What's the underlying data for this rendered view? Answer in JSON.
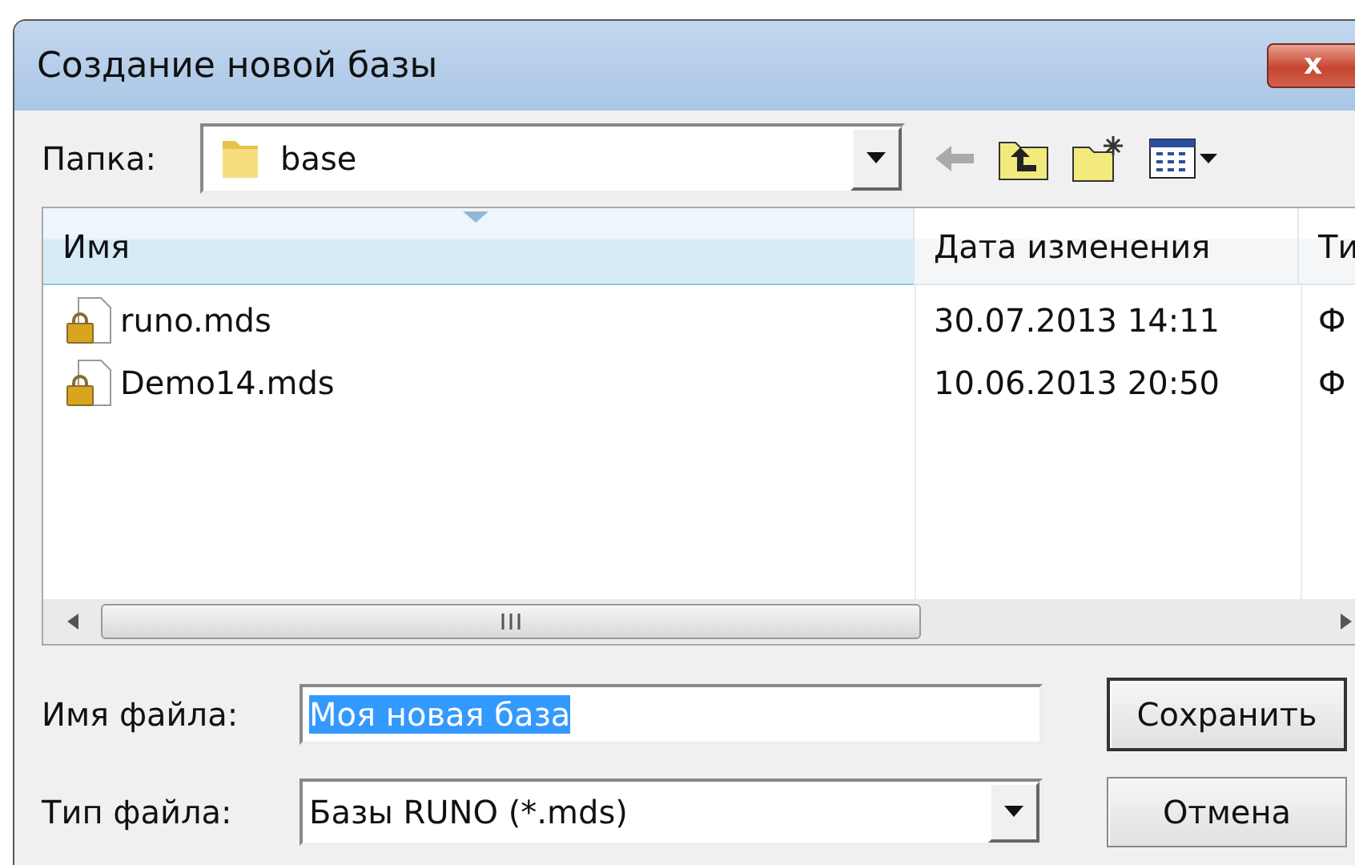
{
  "window": {
    "title": "Создание новой базы",
    "close_glyph": "x"
  },
  "folder": {
    "label": "Папка:",
    "value": "base"
  },
  "table": {
    "columns": [
      {
        "label": "Имя",
        "sorted": true
      },
      {
        "label": "Дата изменения",
        "sorted": false
      },
      {
        "label": "Ти",
        "sorted": false
      }
    ],
    "rows": [
      {
        "cells": [
          "runo.mds",
          "30.07.2013 14:11",
          "Ф"
        ]
      },
      {
        "cells": [
          "Demo14.mds",
          "10.06.2013 20:50",
          "Ф"
        ]
      }
    ]
  },
  "file_name": {
    "label": "Имя файла:",
    "value": "Моя новая база",
    "selected": true
  },
  "file_type": {
    "label": "Тип файла:",
    "value": "Базы RUNO (*.mds)"
  },
  "buttons": [
    {
      "label": "Сохранить",
      "default": true
    },
    {
      "label": "Отмена",
      "default": false
    }
  ]
}
